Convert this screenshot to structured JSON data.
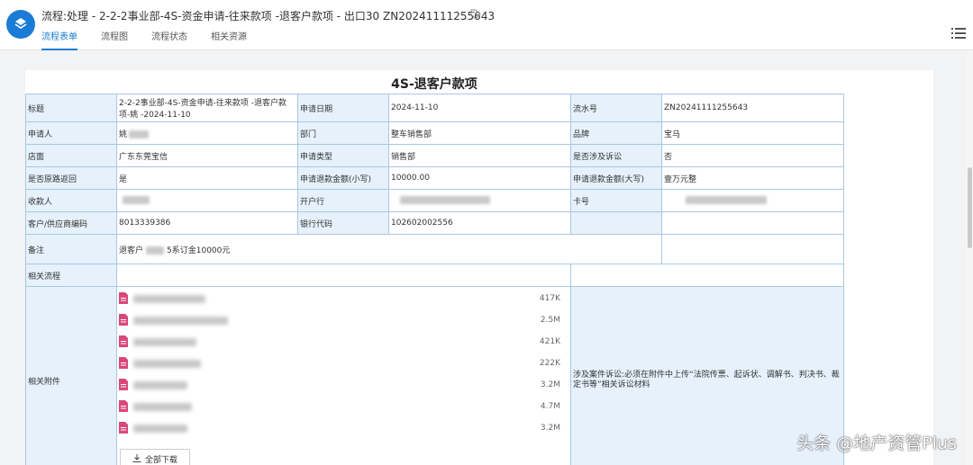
{
  "window": {
    "title": "流程:处理 - 2-2-2事业部-4S-资金申请-往来款项 -退客户款项 - 出口30 ZN20241111255643",
    "tabs": [
      {
        "label": "流程表单",
        "active": true
      },
      {
        "label": "流程图",
        "active": false
      },
      {
        "label": "流程状态",
        "active": false
      },
      {
        "label": "相关资源",
        "active": false
      }
    ]
  },
  "form": {
    "title": "4S-退客户款项",
    "rows": {
      "title_label": "标题",
      "title_value": "2-2-2事业部-4S-资金申请-往来款项 -退客户款项-姚 -2024-11-10",
      "apply_date_label": "申请日期",
      "apply_date_value": "2024-11-10",
      "serial_label": "流水号",
      "serial_value": "ZN20241111255643",
      "applicant_label": "申请人",
      "applicant_value": "姚",
      "dept_label": "部门",
      "dept_value": "整车销售部",
      "brand_label": "品牌",
      "brand_value": "宝马",
      "store_label": "店面",
      "store_value": "广东东莞宝信",
      "apply_type_label": "申请类型",
      "apply_type_value": "销售部",
      "lawsuit_label": "是否涉及诉讼",
      "lawsuit_value": "否",
      "return_label": "是否原路返回",
      "return_value": "是",
      "amount_small_label": "申请退款金额(小写)",
      "amount_small_value": "10000.00",
      "amount_big_label": "申请退款金额(大写)",
      "amount_big_value": "壹万元整",
      "payee_label": "收款人",
      "bank_label": "开户行",
      "card_label": "卡号",
      "customer_code_label": "客户/供应商编码",
      "customer_code_value": "8013339386",
      "bank_code_label": "银行代码",
      "bank_code_value": "102602002556",
      "remark_label": "备注",
      "remark_prefix": "退客户",
      "remark_suffix": "5系订金10000元",
      "related_flow_label": "相关流程",
      "attach_label": "相关附件"
    },
    "attachments": [
      {
        "size": "417K",
        "icon": "pdf-file-icon"
      },
      {
        "size": "2.5M",
        "icon": "pdf-file-icon"
      },
      {
        "size": "421K",
        "icon": "pdf-file-icon"
      },
      {
        "size": "222K",
        "icon": "pdf-file-icon"
      },
      {
        "size": "3.2M",
        "icon": "pdf-file-icon"
      },
      {
        "size": "4.7M",
        "icon": "pdf-file-icon"
      },
      {
        "size": "3.2M",
        "icon": "pdf-file-icon"
      }
    ],
    "download_all_label": "全部下载",
    "notice": "涉及案件诉讼:必须在附件中上传“法院传票、起诉状、调解书、判决书、裁定书等”相关诉讼材料"
  },
  "watermark": "头条 @地产资管Plus",
  "colors": {
    "accent": "#1a7cd6",
    "label_bg": "#e6f1fb",
    "border": "#a9c7e6",
    "notice": "#d0312d",
    "file_icon": "#d9487a"
  }
}
